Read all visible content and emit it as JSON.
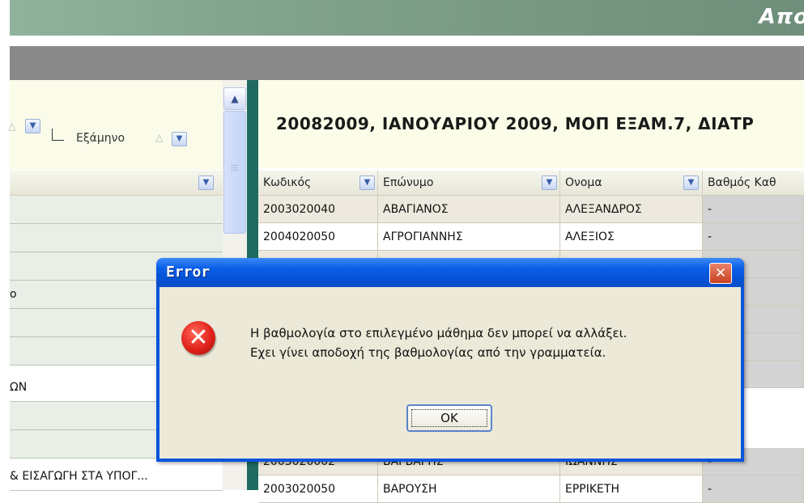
{
  "app": {
    "banner_title": "Απο"
  },
  "left_panel": {
    "semester_label": "Εξάμηνο",
    "sort_arrow": "△",
    "rows": [
      "",
      "",
      "",
      "ο",
      "",
      "",
      "ΩΝ",
      "",
      "",
      "& ΕΙΣΑΓΩΓΗ ΣΤΑ ΥΠΟΓ..."
    ]
  },
  "right_panel": {
    "title": "20082009, ΙΑΝΟΥΑΡΙΟΥ 2009, ΜΟΠ ΕΞΑΜ.7, ΔΙΑΤΡ",
    "columns": [
      "Κωδικός",
      "Επώνυμο",
      "Ονομα",
      "Βαθμός Καθ"
    ],
    "rows": [
      [
        "2003020040",
        "ΑΒΑΓΙΑΝΟΣ",
        "ΑΛΕΞΑΝΔΡΟΣ",
        "-"
      ],
      [
        "2004020050",
        "ΑΓΡΟΓΙΑΝΝΗΣ",
        "ΑΛΕΞΙΟΣ",
        "-"
      ],
      [
        "",
        "",
        "",
        ""
      ],
      [
        "",
        "",
        "",
        ""
      ],
      [
        "",
        "",
        "",
        ""
      ],
      [
        "",
        "",
        "",
        ""
      ],
      [
        "",
        "",
        "",
        ""
      ],
      [
        "2005020002",
        "ΒΑΡΒΑΡΗΣ",
        "ΙΩΑΝΝΗΣ",
        "-"
      ],
      [
        "2003020050",
        "ΒΑΡΟΥΣΗ",
        "ΕΡΡΙΚΕΤΗ",
        "-"
      ]
    ]
  },
  "dialog": {
    "title": "Error",
    "close_glyph": "✕",
    "icon_glyph": "✕",
    "message_line1": "Η βαθμολογία στο επιλεγμένο μάθημα δεν μπορεί να αλλάξει.",
    "message_line2": "Εχει γίνει αποδοχή της βαθμολογίας από την γραμματεία.",
    "ok_label": "OK"
  },
  "icons": {
    "dropdown": "chevron-down-icon",
    "scroll_up": "chevron-up-icon",
    "error": "error-x-icon",
    "close": "close-icon"
  },
  "colors": {
    "accent_teal": "#1f6b60",
    "titlebar_blue": "#0855dd",
    "error_red": "#e0221a"
  }
}
